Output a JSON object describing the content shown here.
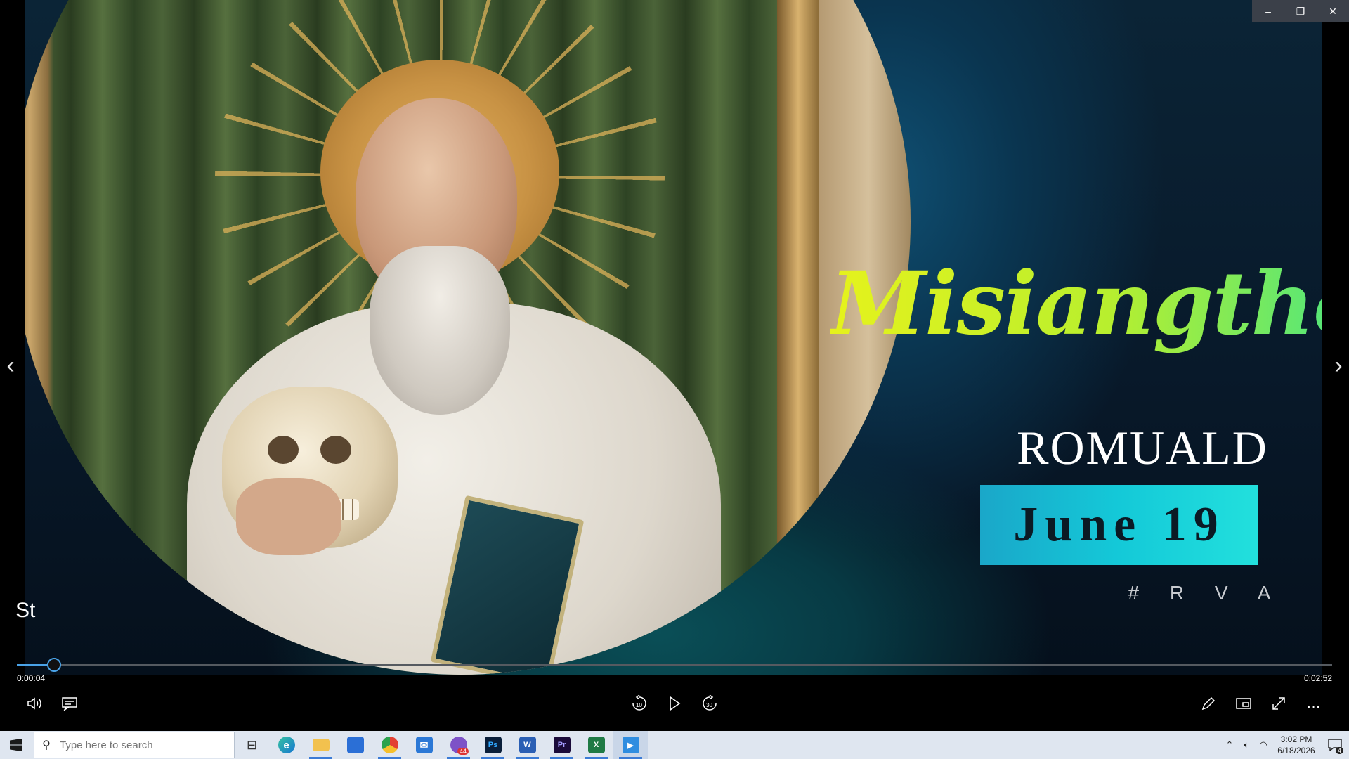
{
  "video": {
    "title_script": "Misiangtho",
    "saint_name": "ROMUALD",
    "date": "June 19",
    "tag": "# R V A"
  },
  "caption": "St",
  "window_controls": {
    "minimize": "–",
    "restore": "❐",
    "close": "✕"
  },
  "player": {
    "current_time": "0:00:04",
    "total_time": "0:02:52",
    "progress_fraction": 0.028,
    "accent": "#4aa3e8",
    "controls": {
      "volume": "volume-icon",
      "subtitles": "subtitles-icon",
      "rewind": "10",
      "forward": "30",
      "play": "play-icon",
      "edit": "pencil-icon",
      "mini": "miniplayer-icon",
      "fullscreen": "fullscreen-icon",
      "more": "..."
    }
  },
  "nav": {
    "prev": "‹",
    "next": "›"
  },
  "taskbar": {
    "search_placeholder": "Type here to search",
    "apps": [
      {
        "name": "task-view",
        "label": "⊟"
      },
      {
        "name": "edge",
        "label": "e"
      },
      {
        "name": "file-explorer",
        "label": ""
      },
      {
        "name": "store",
        "label": ""
      },
      {
        "name": "chrome",
        "label": ""
      },
      {
        "name": "mail",
        "label": "✉"
      },
      {
        "name": "viber",
        "label": "",
        "badge": "44"
      },
      {
        "name": "photoshop",
        "label": "Ps"
      },
      {
        "name": "word",
        "label": "W"
      },
      {
        "name": "premiere",
        "label": "Pr"
      },
      {
        "name": "excel",
        "label": "X"
      },
      {
        "name": "media-player",
        "label": "▶"
      }
    ],
    "clock_time": "3:02 PM",
    "clock_date": "6/18/2026",
    "notifications": "4"
  }
}
